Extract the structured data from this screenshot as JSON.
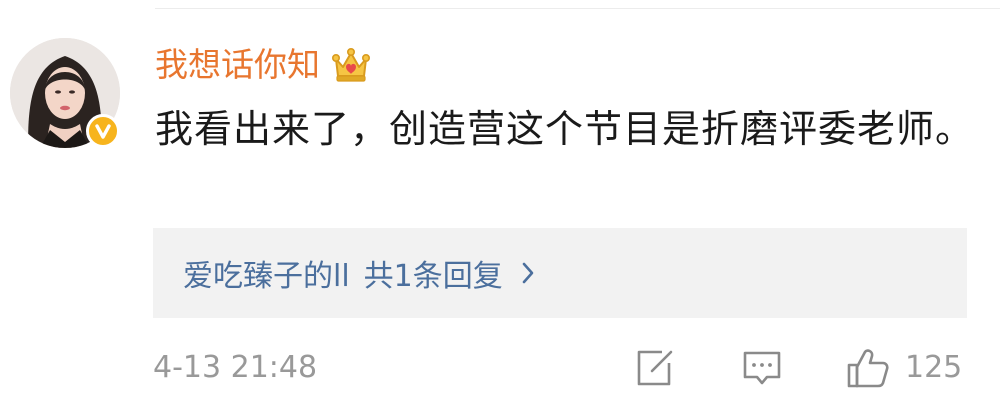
{
  "comment": {
    "username": "我想话你知",
    "text": "我看出来了，创造营这个节目是折磨评委老师。",
    "timestamp": "4-13 21:48",
    "like_count": "125"
  },
  "reply_preview": {
    "user": "爱吃臻子的ll",
    "count_text": "共1条回复"
  },
  "icons": {
    "avatar": "user-avatar",
    "badge": "verified-v-badge",
    "crown": "crown-icon",
    "chevron": "chevron-right-icon",
    "share": "share-icon",
    "comment": "comment-icon",
    "like": "thumbs-up-icon"
  },
  "colors": {
    "username": "#e8762f",
    "reply_link": "#4b6f9d",
    "meta": "#999999",
    "badge": "#f7b41d",
    "reply_bg": "#f2f2f2"
  }
}
